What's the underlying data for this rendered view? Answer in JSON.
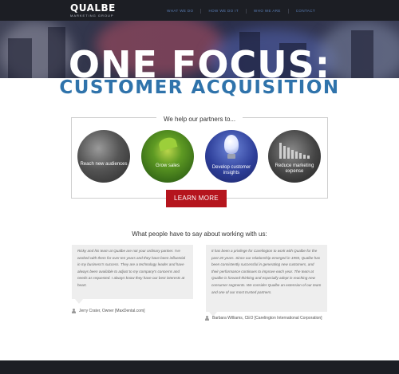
{
  "brand": {
    "name": "QUALBE",
    "tagline": "MARKETING GROUP"
  },
  "nav": {
    "items": [
      "WHAT WE DO",
      "HOW WE DO IT",
      "WHO WE ARE",
      "CONTACT"
    ]
  },
  "hero": {
    "headline": "ONE FOCUS:",
    "subhead": "CUSTOMER ACQUISITION"
  },
  "partners": {
    "title": "We help our partners to...",
    "items": [
      {
        "label": "Reach new audiences",
        "icon": "crowd-icon"
      },
      {
        "label": "Grow sales",
        "icon": "sprout-icon"
      },
      {
        "label": "Develop customer insights",
        "icon": "lightbulb-icon"
      },
      {
        "label": "Reduce marketing expense",
        "icon": "bar-chart-icon"
      }
    ],
    "cta": "LEARN MORE"
  },
  "testimonials": {
    "title": "What people have to say about working with us:",
    "items": [
      {
        "quote": "Ricky and his team at Qualbe are not your ordinary partner. I've worked with them for over ten years and they have been influential in my business's success. They are a technology leader and have always been available to adjust to my company's concerns and needs as requested. I always know they have our best interests at heart.",
        "author": "Jerry Crater, Owner [MaxDental.com]"
      },
      {
        "quote": "It has been a privilege for Carelington to work with Qualbe for the past 20 years. Since our relationship emerged in 1993, Qualbe has been consistently successful in generating new customers, and their performance continues to improve each year. The team at Qualbe is forward-thinking and especially adept in reaching new consumer segments. We consider Qualbe an extension of our team and one of our most trusted partners.",
        "author": "Barbara Williams, CEO [Carelington International Corporation]"
      }
    ]
  }
}
